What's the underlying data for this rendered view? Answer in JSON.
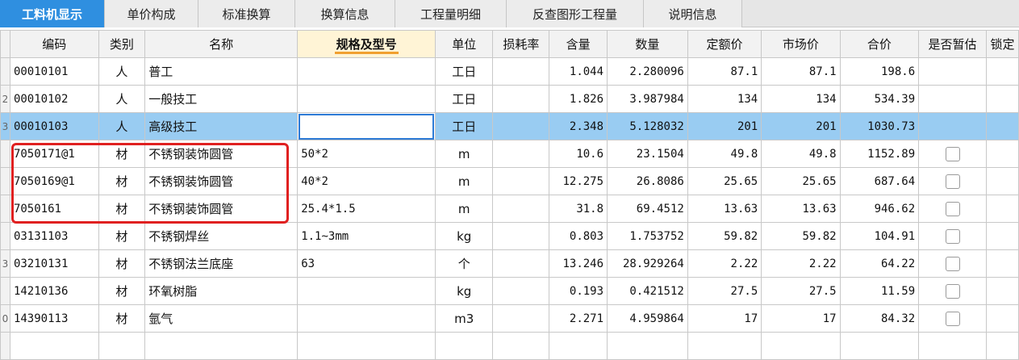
{
  "tabs": [
    {
      "label": "工料机显示",
      "active": true
    },
    {
      "label": "单价构成"
    },
    {
      "label": "标准换算"
    },
    {
      "label": "换算信息"
    },
    {
      "label": "工程量明细"
    },
    {
      "label": "反查图形工程量"
    },
    {
      "label": "说明信息"
    }
  ],
  "columns": [
    "编码",
    "类别",
    "名称",
    "规格及型号",
    "单位",
    "损耗率",
    "含量",
    "数量",
    "定额价",
    "市场价",
    "合价",
    "是否暂估",
    "锁定"
  ],
  "rows": [
    {
      "idx": "",
      "code": "00010101",
      "type": "人",
      "name": "普工",
      "spec": "",
      "unit": "工日",
      "loss": "",
      "content": "1.044",
      "qty": "2.280096",
      "quota": "87.1",
      "market": "87.1",
      "total": "198.6",
      "checkbox": false
    },
    {
      "idx": "2",
      "code": "00010102",
      "type": "人",
      "name": "一般技工",
      "spec": "",
      "unit": "工日",
      "loss": "",
      "content": "1.826",
      "qty": "3.987984",
      "quota": "134",
      "market": "134",
      "total": "534.39",
      "checkbox": false
    },
    {
      "idx": "3",
      "code": "00010103",
      "type": "人",
      "name": "高级技工",
      "spec": "",
      "unit": "工日",
      "loss": "",
      "content": "2.348",
      "qty": "5.128032",
      "quota": "201",
      "market": "201",
      "total": "1030.73",
      "checkbox": false,
      "selected": true
    },
    {
      "idx": "",
      "code": "7050171@1",
      "type": "材",
      "name": "不锈钢装饰圆管",
      "spec": "50*2",
      "unit": "m",
      "loss": "",
      "content": "10.6",
      "qty": "23.1504",
      "quota": "49.8",
      "market": "49.8",
      "total": "1152.89",
      "checkbox": true
    },
    {
      "idx": "",
      "code": "7050169@1",
      "type": "材",
      "name": "不锈钢装饰圆管",
      "spec": "40*2",
      "unit": "m",
      "loss": "",
      "content": "12.275",
      "qty": "26.8086",
      "quota": "25.65",
      "market": "25.65",
      "total": "687.64",
      "checkbox": true
    },
    {
      "idx": "",
      "code": "7050161",
      "type": "材",
      "name": "不锈钢装饰圆管",
      "spec": "25.4*1.5",
      "unit": "m",
      "loss": "",
      "content": "31.8",
      "qty": "69.4512",
      "quota": "13.63",
      "market": "13.63",
      "total": "946.62",
      "checkbox": true
    },
    {
      "idx": "",
      "code": "03131103",
      "type": "材",
      "name": "不锈钢焊丝",
      "spec": "1.1~3mm",
      "unit": "kg",
      "loss": "",
      "content": "0.803",
      "qty": "1.753752",
      "quota": "59.82",
      "market": "59.82",
      "total": "104.91",
      "checkbox": true
    },
    {
      "idx": "3",
      "code": "03210131",
      "type": "材",
      "name": "不锈钢法兰底座",
      "spec": "63",
      "unit": "个",
      "loss": "",
      "content": "13.246",
      "qty": "28.929264",
      "quota": "2.22",
      "market": "2.22",
      "total": "64.22",
      "checkbox": true
    },
    {
      "idx": "",
      "code": "14210136",
      "type": "材",
      "name": "环氧树脂",
      "spec": "",
      "unit": "kg",
      "loss": "",
      "content": "0.193",
      "qty": "0.421512",
      "quota": "27.5",
      "market": "27.5",
      "total": "11.59",
      "checkbox": true
    },
    {
      "idx": "0",
      "code": "14390113",
      "type": "材",
      "name": "氩气",
      "spec": "",
      "unit": "m3",
      "loss": "",
      "content": "2.271",
      "qty": "4.959864",
      "quota": "17",
      "market": "17",
      "total": "84.32",
      "checkbox": true
    },
    {
      "idx": "",
      "code": "",
      "type": "",
      "name": "",
      "spec": "",
      "unit": "",
      "loss": "",
      "content": "",
      "qty": "",
      "quota": "",
      "market": "",
      "total": "",
      "checkbox": false
    }
  ],
  "colors": {
    "active_tab": "#2f8fe0",
    "selected_row": "#99ccf2",
    "highlight_box": "#e02020"
  }
}
